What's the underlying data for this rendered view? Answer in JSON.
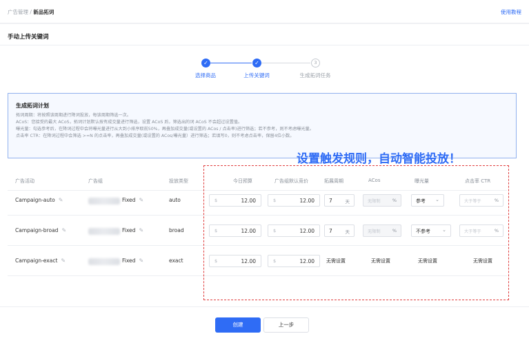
{
  "breadcrumb": {
    "parent": "广告管理",
    "separator": "/",
    "current": "新品拓词"
  },
  "help_link": "使用教程",
  "page_title": "手动上传关键词",
  "steps": [
    {
      "label": "选择商品",
      "state": "done",
      "icon": "check-icon"
    },
    {
      "label": "上传关键词",
      "state": "done",
      "icon": "check-icon"
    },
    {
      "label": "生成拓词任务",
      "state": "todo",
      "number": "3"
    }
  ],
  "info": {
    "title": "生成拓词计划",
    "lines": [
      "拓词周期：将按照该周期进行降词投放，每该周期筛选一次。",
      "ACoS：您接受的最大 ACoS，拓词计划默认按有成交量进行筛选，设置 ACoS 后，筛选出的词 ACoS 不会超过设置值。",
      "曝光量：勾选参考后，在降词过程中会将曝光量进行从大到小排序取前50%，再叠加成交量(或设置的 ACos / 点击率)进行筛选；若不参考，则不考虑曝光量。",
      "点击率 CTR：在降词过程中会筛选 >=N 的点击率，再叠加成交量(或设置的 ACos/曝光量）进行筛选；若填写0，则不考虑点击率，保留4位小数。"
    ]
  },
  "promo_text": "设置触发规则，自动智能投放！",
  "table": {
    "headers": [
      "广告活动",
      "广告组",
      "投放类型",
      "今日预算",
      "广告组默认竞价",
      "拓展周期",
      "ACos",
      "曝光量",
      "点击率 CTR"
    ],
    "currency": "$",
    "days_unit": "天",
    "acos_placeholder": "无限制",
    "percent": "%",
    "ctr_placeholder": "大于等于",
    "rows": [
      {
        "campaign": "Campaign-auto",
        "group_suffix": "Fixed",
        "type": "auto",
        "budget": "12.00",
        "bid": "12.00",
        "period": "7",
        "exposure": "参考",
        "editable": true
      },
      {
        "campaign": "Campaign-broad",
        "group_suffix": "Fixed",
        "type": "broad",
        "budget": "12.00",
        "bid": "12.00",
        "period": "7",
        "exposure": "不参考",
        "editable": true
      },
      {
        "campaign": "Campaign-exact",
        "group_suffix": "Fixed",
        "type": "exact",
        "budget": "12.00",
        "bid": "12.00",
        "period_text": "无需设置",
        "acos_text": "无需设置",
        "exposure_text": "无需设置",
        "ctr_text": "无需设置",
        "editable": false
      }
    ]
  },
  "buttons": {
    "create": "创建",
    "back": "上一步"
  },
  "colors": {
    "primary": "#2f6cf5",
    "highlight_border": "#e03d3d",
    "info_border": "#8fb0ee"
  }
}
